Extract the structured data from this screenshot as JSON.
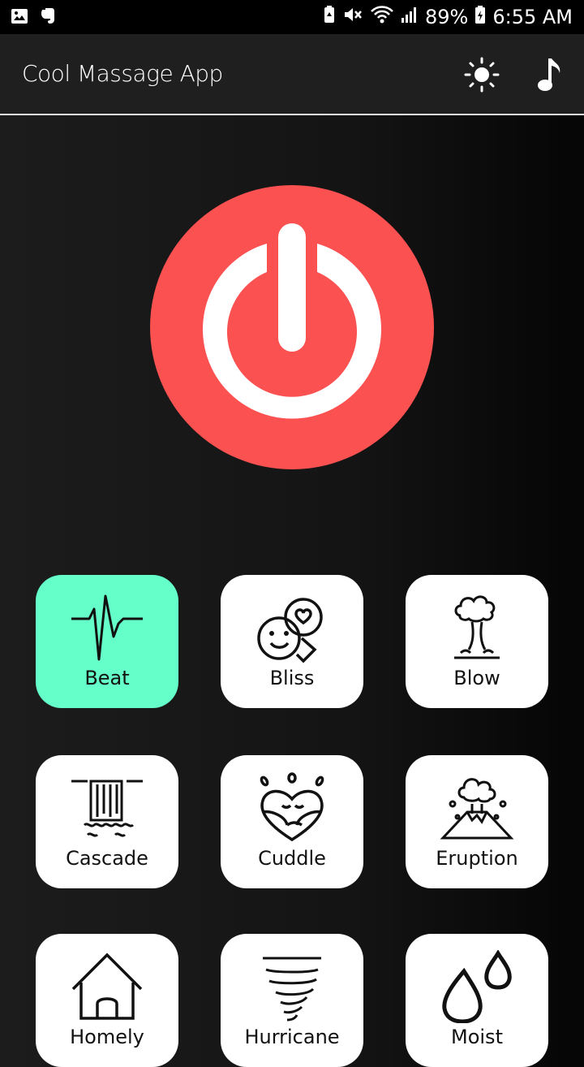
{
  "status_bar": {
    "icons_left": [
      "image-icon",
      "evernote-icon"
    ],
    "icons_right": [
      "battery-saver-icon",
      "mute-icon",
      "wifi-icon",
      "signal-icon"
    ],
    "battery": "89%",
    "time": "6:55 AM"
  },
  "app_bar": {
    "title": "Cool Massage App",
    "actions": [
      "brightness-icon",
      "music-note-icon"
    ]
  },
  "power_button": {
    "icon": "power-icon",
    "color": "#fc5151"
  },
  "modes": [
    {
      "label": "Beat",
      "icon": "heartbeat-icon",
      "active": true
    },
    {
      "label": "Bliss",
      "icon": "happy-love-chat-icon",
      "active": false
    },
    {
      "label": "Blow",
      "icon": "geyser-icon",
      "active": false
    },
    {
      "label": "Cascade",
      "icon": "waterfall-icon",
      "active": false
    },
    {
      "label": "Cuddle",
      "icon": "hugging-heart-icon",
      "active": false
    },
    {
      "label": "Eruption",
      "icon": "volcano-icon",
      "active": false
    },
    {
      "label": "Homely",
      "icon": "house-icon",
      "active": false
    },
    {
      "label": "Hurricane",
      "icon": "tornado-icon",
      "active": false
    },
    {
      "label": "Moist",
      "icon": "water-drops-icon",
      "active": false
    }
  ],
  "colors": {
    "accent_active": "#65ffc9",
    "tile": "#ffffff",
    "power": "#fc5151"
  }
}
